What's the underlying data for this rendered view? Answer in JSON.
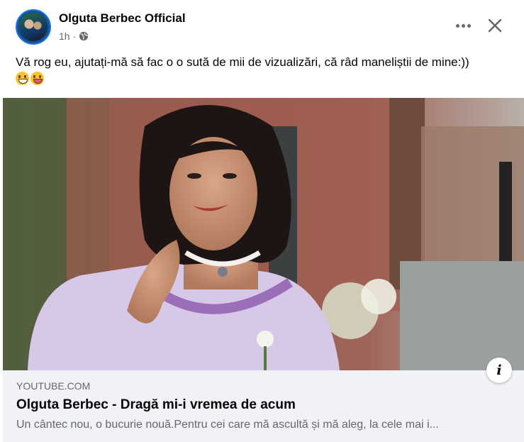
{
  "post": {
    "author": "Olguta Berbec Official",
    "time": "1h",
    "audience_icon": "globe-icon",
    "text": "Vă rog eu, ajutați-mă să fac o o sută de mii de vizualizări, că râd maneliștii de mine:))",
    "emojis": [
      "grinning-sweat-emoji",
      "winking-tongue-emoji"
    ]
  },
  "actions": {
    "more_icon": "more-options-icon",
    "close_icon": "close-icon"
  },
  "media": {
    "description_icon": "info-icon",
    "info_label": "i"
  },
  "link": {
    "domain": "YOUTUBE.COM",
    "title": "Olguta Berbec - Dragă mi-i vremea de acum",
    "description": "Un cântec nou, o bucurie nouă.Pentru cei care mă ascultă și mă aleg, la cele mai i..."
  },
  "colors": {
    "text": "#050505",
    "secondary": "#65676b",
    "link_bg": "#f0f2f5",
    "accent": "#1877f2"
  }
}
